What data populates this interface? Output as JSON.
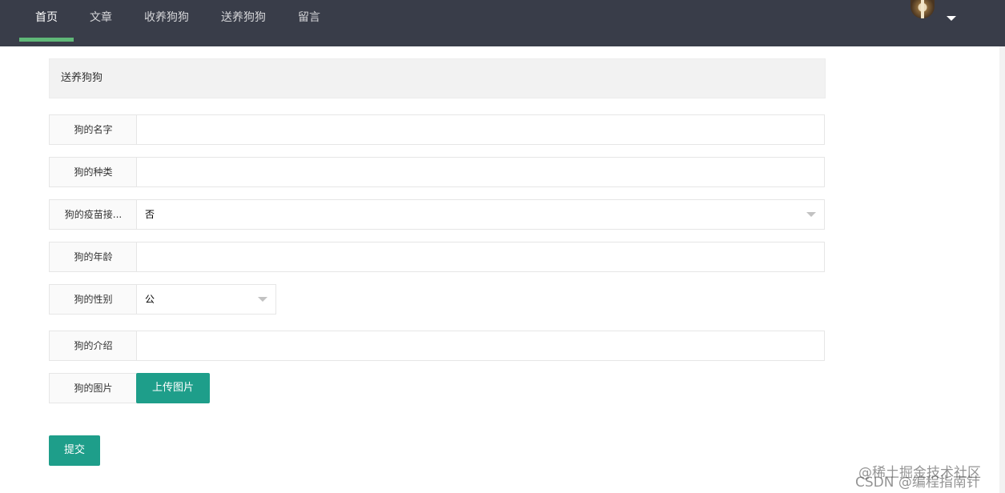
{
  "nav": {
    "items": [
      "首页",
      "文章",
      "收养狗狗",
      "送养狗狗",
      "留言"
    ],
    "active_index": 0
  },
  "panel": {
    "title": "送养狗狗"
  },
  "form": {
    "name_label": "狗的名字",
    "breed_label": "狗的种类",
    "vaccine_label": "狗的疫苗接...",
    "vaccine_value": "否",
    "age_label": "狗的年龄",
    "gender_label": "狗的性别",
    "gender_value": "公",
    "intro_label": "狗的介绍",
    "image_label": "狗的图片",
    "upload_label": "上传图片",
    "submit_label": "提交"
  },
  "watermark": {
    "line1": "@稀土掘金技术社区",
    "line2": "CSDN @编程指南针"
  },
  "colors": {
    "topbar": "#393d49",
    "nav_active_indicator": "#5fb878",
    "button": "#1e9e8a"
  }
}
